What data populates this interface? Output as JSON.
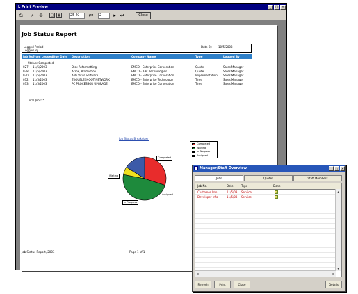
{
  "print_preview": {
    "title": "L Print Preview",
    "window_buttons": [
      "_",
      "□",
      "×"
    ],
    "toolbar": {
      "zoom_value": "25 %",
      "page_value": "2",
      "close_label": "Close"
    },
    "report": {
      "title": "Job Status Report",
      "logged_in_label": "Logged Period",
      "logged_by_label": "Logged By",
      "date_label": "Date By",
      "date_value": "10/5/2003",
      "columns": [
        "Job No.",
        "From Logged",
        "Due Date",
        "Description",
        "Company Name",
        "Type",
        "Logged By"
      ],
      "status_text": "Status: Completed",
      "rows": [
        [
          "027",
          "11/5/2003",
          "Disk Reformatting",
          "EMCO - Enterprise Corporation",
          "Quote",
          "Sales Manager"
        ],
        [
          "028",
          "11/5/2003",
          "Acme, Production",
          "EMCO - ABC Technologies",
          "Quote",
          "Sales Manager"
        ],
        [
          "030",
          "11/5/2003",
          "Anti Virus Software",
          "EMCO - Enterprise Corporation",
          "Implementation",
          "Sales Manager"
        ],
        [
          "032",
          "11/5/2003",
          "TROUBLESHOOT NETWORK",
          "EMCO - Enterprise Technology",
          "Time",
          "Sales Manager"
        ],
        [
          "033",
          "11/5/2003",
          "PC PROCESSOR UPGRADE",
          "EMCO - Enterprise Corporation",
          "Time",
          "Sales Manager"
        ]
      ],
      "total_text": "Total Jobs: 5",
      "chart_title": "Job Status Breakdown",
      "footer_left": "Job Status Report, 2003",
      "footer_right": "Page 1 of 1"
    },
    "chart_data": {
      "type": "pie",
      "title": "Job Status Breakdown",
      "series": [
        {
          "name": "Completed",
          "value": 30,
          "color": "#e82c2c"
        },
        {
          "name": "Waiting",
          "value": 48,
          "color": "#1e8a3c"
        },
        {
          "name": "In Progress",
          "value": 6,
          "color": "#f0e020"
        },
        {
          "name": "Assigned",
          "value": 16,
          "color": "#3c5aa8"
        }
      ],
      "legend_position": "right",
      "legend_items": [
        "Completed",
        "Waiting",
        "In Progress",
        "Assigned"
      ],
      "slice_labels": [
        "Completed",
        "Waiting",
        "In Progress",
        "Assigned"
      ]
    }
  },
  "overview": {
    "title": "Manager/Staff Overview",
    "tabs": [
      "Jobs",
      "Quotes",
      "Staff Members"
    ],
    "columns": [
      "Job No.",
      "Date",
      "Type",
      "Done"
    ],
    "rows": [
      {
        "c1": "Customer Info",
        "c2": "11/5/03",
        "c3": "Service",
        "done": true
      },
      {
        "c1": "Developer Info",
        "c2": "11/5/03",
        "c3": "Service",
        "done": true
      }
    ],
    "buttons": [
      "Refresh",
      "Print",
      "Close",
      "Details"
    ]
  }
}
